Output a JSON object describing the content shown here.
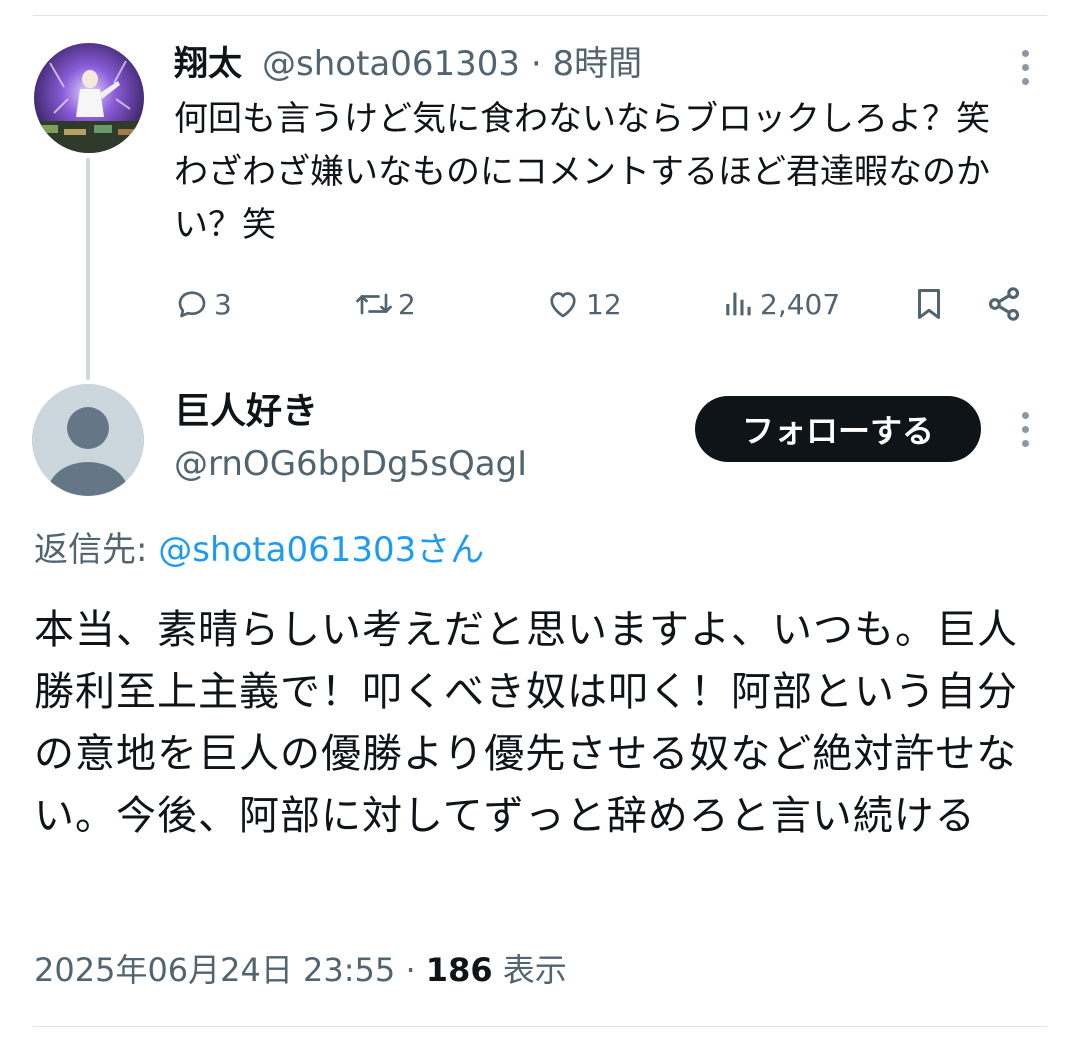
{
  "parent_tweet": {
    "name": "翔太",
    "handle": "@shota061303",
    "separator": "·",
    "time": "8時間",
    "text": "何回も言うけど気に食わないならブロックしろよ？笑　わざわざ嫌いなものにコメントするほど君達暇なのかい？笑",
    "actions": {
      "replies": "3",
      "reposts": "2",
      "likes": "12",
      "views": "2,407"
    }
  },
  "reply_tweet": {
    "name": "巨人好き",
    "handle": "@rnOG6bpDg5sQagI",
    "follow_label": "フォローする",
    "reply_to_prefix": "返信先: ",
    "reply_to_mention": "@shota061303さん",
    "text": "本当、素晴らしい考えだと思いますよ、いつも。巨人勝利至上主義で！叩くべき奴は叩く！阿部という自分の意地を巨人の優勝より優先させる奴など絶対許せない。今後、阿部に対してずっと辞めろと言い続ける",
    "date": "2025年06月24日 23:55",
    "separator": "·",
    "view_count": "186",
    "view_label": " 表示"
  },
  "colors": {
    "text": "#0f1419",
    "secondary": "#536471",
    "link": "#1d9bf0",
    "divider": "#dfe3e6",
    "button_bg": "#0f1419"
  },
  "icons": [
    "reply-icon",
    "repost-icon",
    "like-icon",
    "views-icon",
    "bookmark-icon",
    "share-icon",
    "more-icon",
    "default-avatar-icon"
  ]
}
